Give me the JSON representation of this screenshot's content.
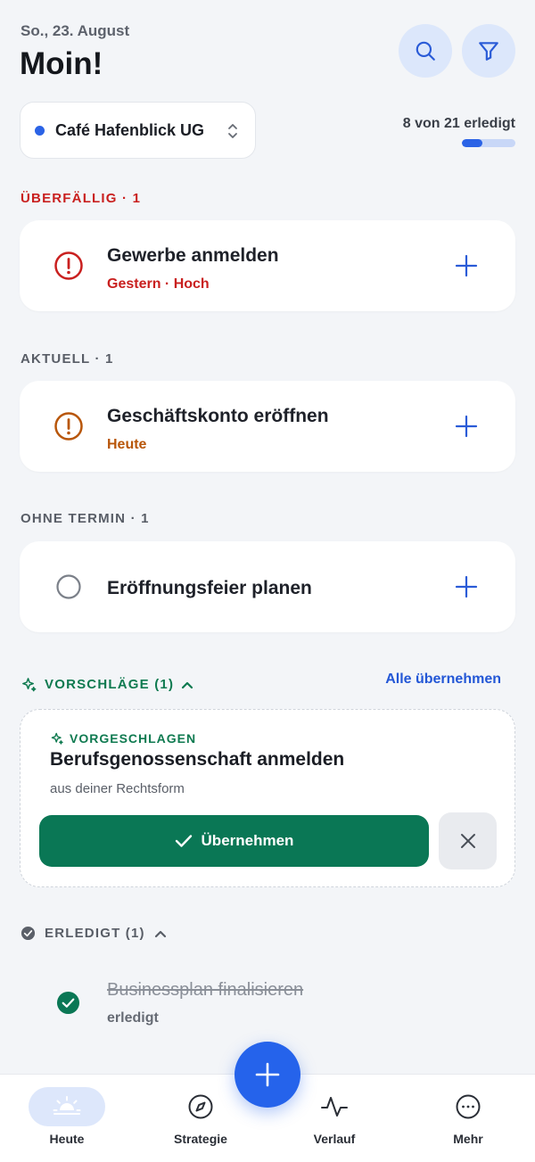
{
  "header": {
    "date": "So., 23. August",
    "greeting": "Moin!",
    "search_icon": "search-icon",
    "filter_icon": "filter-icon"
  },
  "company": {
    "name": "Café Hafenblick UG",
    "dot_color": "#2b63e6"
  },
  "progress": {
    "label": "8 von 21 erledigt",
    "done": 8,
    "total": 21
  },
  "sections": {
    "overdue": {
      "label": "ÜBERFÄLLIG · 1",
      "task": {
        "title": "Gewerbe anmelden",
        "sub": "Gestern · Hoch",
        "color": "#c9201f"
      }
    },
    "current": {
      "label": "AKTUELL · 1",
      "task": {
        "title": "Geschäftskonto eröffnen",
        "sub": "Heute",
        "color": "#b8560a"
      }
    },
    "no_date": {
      "label": "OHNE TERMIN · 1",
      "task": {
        "title": "Eröffnungsfeier planen"
      }
    }
  },
  "suggestions": {
    "label": "VORSCHLÄGE (1)",
    "accept_all": "Alle übernehmen",
    "card": {
      "tag": "VORGESCHLAGEN",
      "title": "Berufsgenossenschaft anmelden",
      "sub": "aus deiner Rechtsform",
      "accept_label": "Übernehmen"
    }
  },
  "done": {
    "label": "ERLEDIGT (1)",
    "item": {
      "title": "Businessplan finalisieren",
      "sub": "erledigt"
    }
  },
  "tabs": [
    {
      "label": "Heute",
      "icon": "sunrise-icon",
      "active": true
    },
    {
      "label": "Strategie",
      "icon": "compass-icon",
      "active": false
    },
    {
      "label": "Verlauf",
      "icon": "activity-icon",
      "active": false
    },
    {
      "label": "Mehr",
      "icon": "more-icon",
      "active": false
    }
  ],
  "colors": {
    "accent": "#2563eb",
    "success": "#0a7755",
    "danger": "#c9201f",
    "warning": "#b8560a"
  }
}
